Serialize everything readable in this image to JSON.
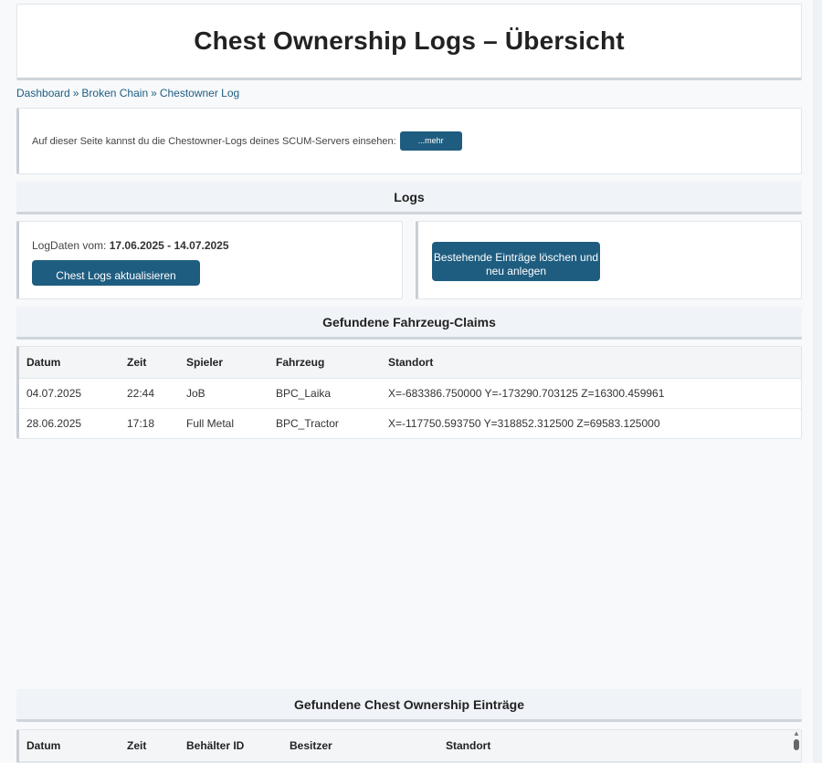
{
  "page": {
    "title": "Chest Ownership Logs – Übersicht"
  },
  "breadcrumb": {
    "items": [
      "Dashboard",
      "Broken Chain",
      "Chestowner Log"
    ],
    "separator": "»"
  },
  "info": {
    "text": "Auf dieser Seite kannst du die Chestowner-Logs deines SCUM-Servers einsehen:",
    "more_button": "...mehr"
  },
  "logs_section": {
    "heading": "Logs",
    "date_label": "LogDaten vom:",
    "date_range": "17.06.2025 - 14.07.2025",
    "update_button": "Chest Logs aktualisieren",
    "reset_button": "Bestehende Einträge löschen und neu anlegen"
  },
  "vehicle_claims": {
    "heading": "Gefundene Fahrzeug-Claims",
    "columns": [
      "Datum",
      "Zeit",
      "Spieler",
      "Fahrzeug",
      "Standort"
    ],
    "rows": [
      [
        "04.07.2025",
        "22:44",
        "JoB",
        "BPC_Laika",
        "X=-683386.750000 Y=-173290.703125 Z=16300.459961"
      ],
      [
        "28.06.2025",
        "17:18",
        "Full Metal",
        "BPC_Tractor",
        "X=-117750.593750 Y=318852.312500 Z=69583.125000"
      ]
    ]
  },
  "chest_entries": {
    "heading": "Gefundene Chest Ownership Einträge",
    "columns": [
      "Datum",
      "Zeit",
      "Behälter ID",
      "Besitzer",
      "Standort"
    ]
  },
  "colors": {
    "accent": "#1f5d80",
    "section_bg": "#f0f4f8"
  }
}
